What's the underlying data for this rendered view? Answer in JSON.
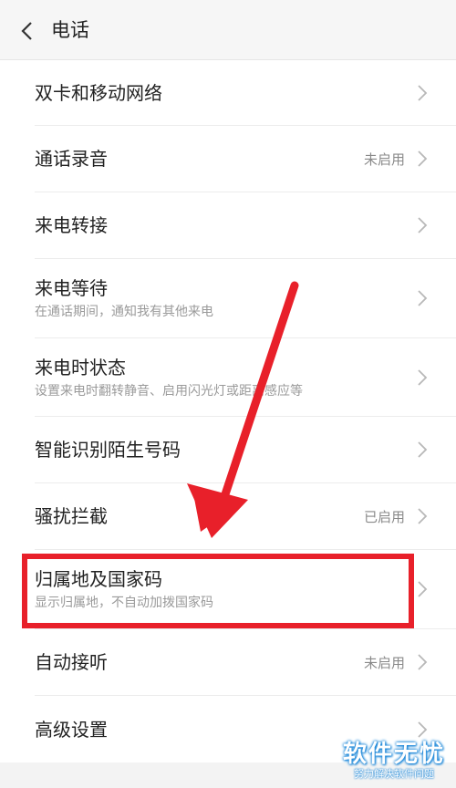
{
  "header": {
    "title": "电话",
    "back_icon": "chevron-left-icon"
  },
  "items": [
    {
      "label": "双卡和移动网络",
      "sub": "",
      "status": ""
    },
    {
      "label": "通话录音",
      "sub": "",
      "status": "未启用"
    },
    {
      "label": "来电转接",
      "sub": "",
      "status": ""
    },
    {
      "label": "来电等待",
      "sub": "在通话期间，通知我有其他来电",
      "status": ""
    },
    {
      "label": "来电时状态",
      "sub": "设置来电时翻转静音、启用闪光灯或距离感应等",
      "status": ""
    },
    {
      "label": "智能识别陌生号码",
      "sub": "",
      "status": ""
    },
    {
      "label": "骚扰拦截",
      "sub": "",
      "status": "已启用"
    },
    {
      "label": "归属地及国家码",
      "sub": "显示归属地，不自动加拨国家码",
      "status": ""
    },
    {
      "label": "自动接听",
      "sub": "",
      "status": "未启用"
    },
    {
      "label": "高级设置",
      "sub": "",
      "status": ""
    }
  ],
  "annotation": {
    "color": "#e8202a"
  },
  "watermark": {
    "main": "软件无忧",
    "sub": "努力解决软件问题"
  }
}
